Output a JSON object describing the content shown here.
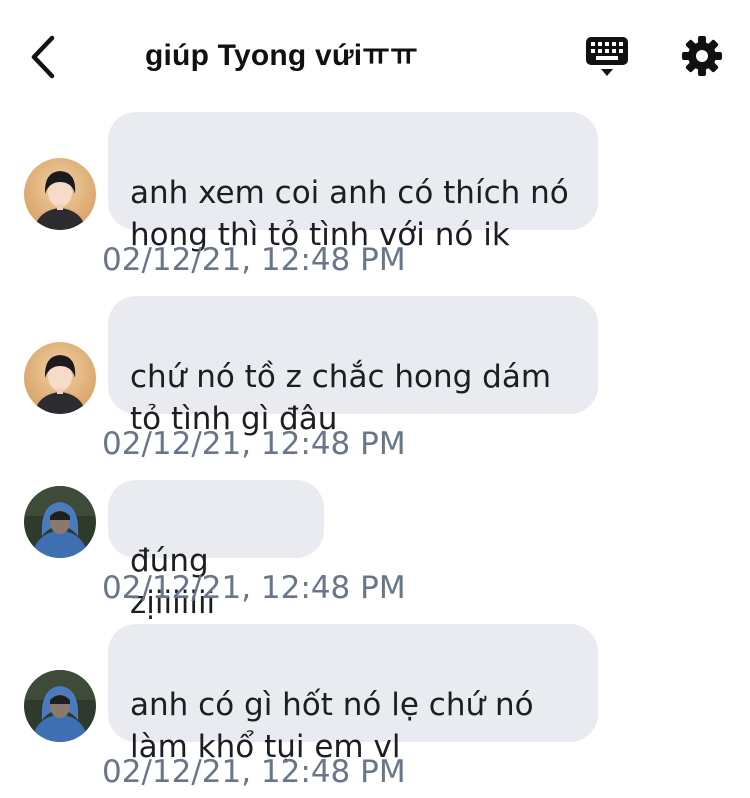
{
  "header": {
    "back_icon": "chevron-left-icon",
    "title": "giúp Tyong vứiㅠㅠ",
    "keyboard_icon": "keyboard-icon",
    "settings_icon": "gear-icon"
  },
  "messages": [
    {
      "avatar": "avatar-person-light-hair",
      "text": "anh xem coi anh có thích nó\nhong thì tỏ tình với nó ik",
      "timestamp": "02/12/21, 12:48 PM"
    },
    {
      "avatar": "avatar-person-light-hair",
      "text": "chứ nó tồ z chắc hong dám\ntỏ tình gì đâu",
      "timestamp": "02/12/21, 12:48 PM"
    },
    {
      "avatar": "avatar-person-blue-hoodie",
      "text": "đúng zịiiiiiii",
      "timestamp": "02/12/21, 12:48 PM"
    },
    {
      "avatar": "avatar-person-blue-hoodie",
      "text": "anh có gì hốt nó lẹ chứ nó\nlàm khổ tụi em vl",
      "timestamp": "02/12/21, 12:48 PM"
    }
  ]
}
